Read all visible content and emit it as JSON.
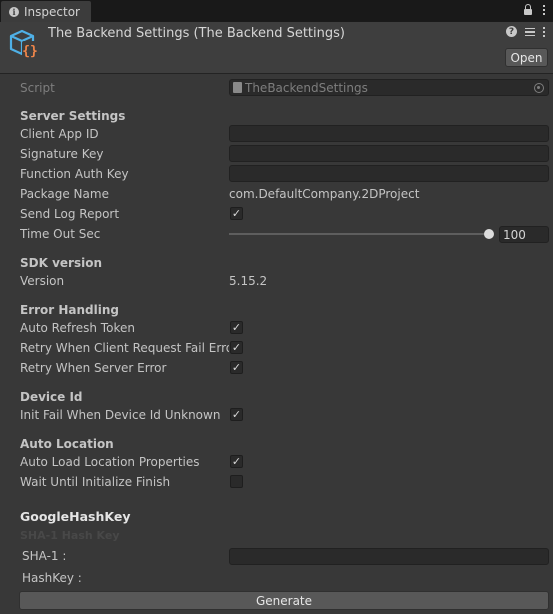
{
  "tab": {
    "label": "Inspector",
    "info_icon": "info-icon",
    "lock_icon": "lock-icon",
    "menu_icon": "more-vert-icon"
  },
  "header": {
    "icon": "csharp-script-icon",
    "title": "The Backend Settings (The Backend Settings)",
    "open_label": "Open"
  },
  "script": {
    "label": "Script",
    "value": "TheBackendSettings"
  },
  "server_settings": {
    "title": "Server Settings",
    "client_app_id": "Client App ID",
    "signature_key": "Signature Key",
    "function_auth_key": "Function Auth Key",
    "package_name_label": "Package Name",
    "package_name_value": "com.DefaultCompany.2DProject",
    "send_log_report": "Send Log Report",
    "send_log_report_checked": true,
    "time_out_sec": "Time Out Sec",
    "time_out_value": "100",
    "time_out_fraction": 1.0
  },
  "sdk_version": {
    "title": "SDK version",
    "label": "Version",
    "value": "5.15.2"
  },
  "error_handling": {
    "title": "Error Handling",
    "auto_refresh_token": "Auto Refresh Token",
    "retry_client": "Retry When Client Request Fail Error",
    "retry_server": "Retry When Server Error"
  },
  "device_id": {
    "title": "Device Id",
    "init_fail": "Init Fail When Device Id Unknown"
  },
  "auto_location": {
    "title": "Auto Location",
    "auto_load": "Auto Load Location Properties",
    "wait_until": "Wait Until Initialize Finish"
  },
  "google_hash": {
    "title": "GoogleHashKey",
    "faded_label": "SHA-1 Hash Key",
    "sha1_label": "SHA-1 :",
    "hashkey_label": "HashKey :",
    "generate_label": "Generate"
  },
  "check_glyph": "✓",
  "colors": {
    "background": "#383838",
    "field": "#2a2a2a",
    "button": "#585858",
    "tabbar": "#191919"
  }
}
